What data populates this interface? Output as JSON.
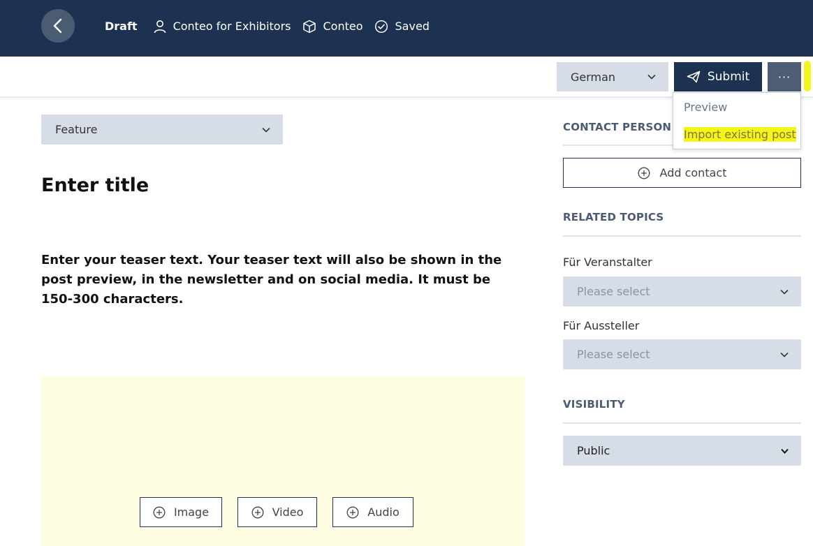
{
  "header": {
    "status": "Draft",
    "user_label": "Conteo for Exhibitors",
    "project_label": "Conteo",
    "save_state": "Saved",
    "icons": {
      "back": "chevron-left-icon",
      "user": "user-icon",
      "project": "cube-icon",
      "saved": "check-circle-icon"
    }
  },
  "toolbar": {
    "language": "German",
    "submit_label": "Submit",
    "more_label": "···",
    "menu": [
      {
        "label": "Preview",
        "highlighted": false
      },
      {
        "label": "Import existing post",
        "highlighted": true
      }
    ]
  },
  "editor": {
    "post_type": "Feature",
    "title_placeholder": "Enter title",
    "teaser_placeholder": "Enter your teaser text. Your teaser text will also be shown in the post preview, in the newsletter and on social media. It must be 150-300 characters.",
    "media_buttons": [
      "Image",
      "Video",
      "Audio"
    ]
  },
  "sidebar": {
    "contact_heading": "CONTACT PERSON",
    "add_contact_label": "Add contact",
    "topics_heading": "RELATED TOPICS",
    "topics": [
      {
        "label": "Für Veranstalter",
        "value": "Please select"
      },
      {
        "label": "Für Aussteller",
        "value": "Please select"
      }
    ],
    "visibility_heading": "VISIBILITY",
    "visibility_value": "Public"
  },
  "colors": {
    "header_bg": "#1d3150",
    "select_bg": "#d6dde6",
    "highlight": "#f4f31a",
    "media_bg": "#fefde1"
  }
}
